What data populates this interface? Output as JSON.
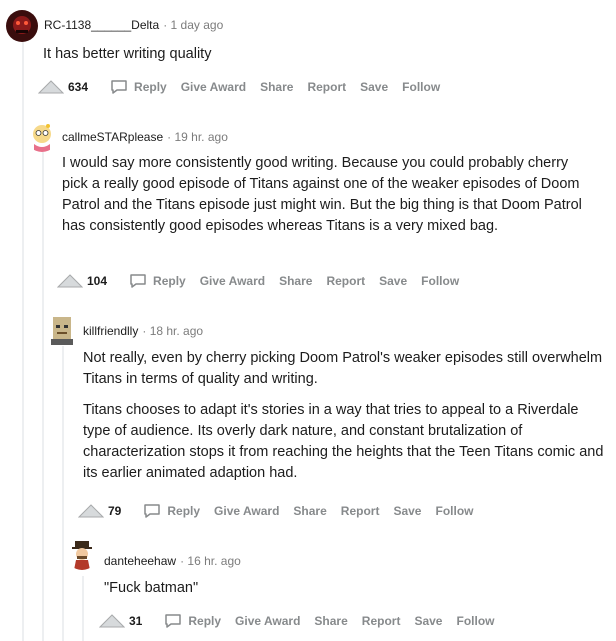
{
  "actions": {
    "reply": "Reply",
    "give_award": "Give Award",
    "share": "Share",
    "report": "Report",
    "save": "Save",
    "follow": "Follow"
  },
  "comments": [
    {
      "username": "RC-1138______Delta",
      "time": "· 1 day ago",
      "paragraphs": [
        "It has better writing quality"
      ],
      "votes": "634"
    },
    {
      "username": "callmeSTARplease",
      "time": "· 19 hr. ago",
      "paragraphs": [
        "I would say more consistently good writing. Because you could probably cherry pick a really good episode of Titans against one of the weaker episodes of Doom Patrol and the Titans episode just might win. But the big thing is that Doom Patrol has consistently good episodes whereas Titans is a very mixed bag."
      ],
      "votes": "104"
    },
    {
      "username": "killfriendlly",
      "time": "· 18 hr. ago",
      "paragraphs": [
        "Not really, even by cherry picking Doom Patrol's weaker episodes still overwhelm Titans in terms of quality and writing.",
        "Titans chooses to adapt it's stories in a way that tries to appeal to a Riverdale type of audience. Its overly dark nature, and constant brutalization of characterization stops it from reaching the heights that the Teen Titans comic and its earlier animated adaption had."
      ],
      "votes": "79"
    },
    {
      "username": "danteheehaw",
      "time": "· 16 hr. ago",
      "paragraphs": [
        "\"Fuck batman\""
      ],
      "votes": "31"
    }
  ]
}
